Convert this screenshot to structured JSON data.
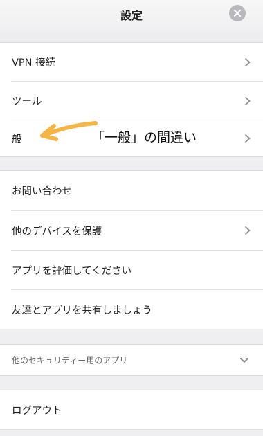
{
  "header": {
    "title": "設定"
  },
  "section1": {
    "items": [
      {
        "label": "VPN 接続",
        "has_chevron": true
      },
      {
        "label": "ツール",
        "has_chevron": true
      },
      {
        "label": "般",
        "has_chevron": true
      }
    ]
  },
  "annotation": {
    "text": "「一般」の間違い",
    "arrow_color": "#f5b544"
  },
  "section2": {
    "items": [
      {
        "label": "お問い合わせ",
        "has_chevron": false
      },
      {
        "label": "他のデバイスを保護",
        "has_chevron": true
      },
      {
        "label": "アプリを評価してください",
        "has_chevron": false
      },
      {
        "label": "友達とアプリを共有しましょう",
        "has_chevron": false
      }
    ]
  },
  "section3": {
    "label": "他のセキュリティー用のアプリ",
    "icon": "chevron-down-icon"
  },
  "section4": {
    "label": "ログアウト"
  },
  "colors": {
    "background": "#efeff1",
    "chevron": "#8e8e93",
    "close_button": "#b9b9bd"
  }
}
